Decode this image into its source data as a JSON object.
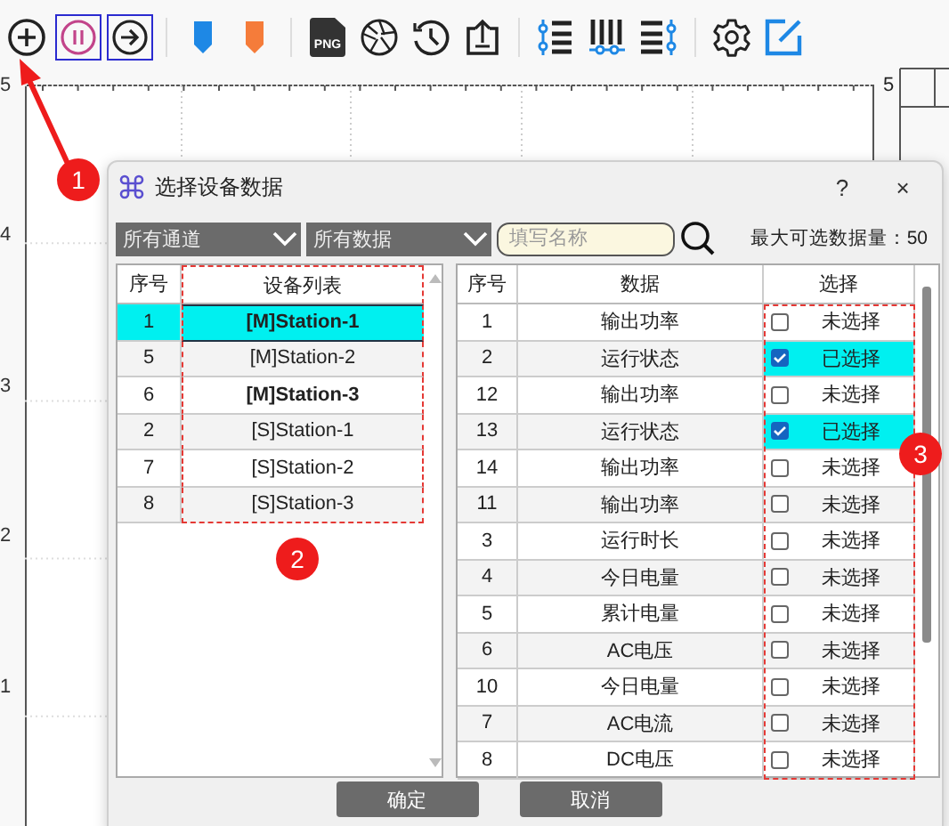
{
  "toolbar": [
    {
      "kind": "add",
      "active": false
    },
    {
      "kind": "pause",
      "active": true
    },
    {
      "kind": "next",
      "active": true
    },
    {
      "kind": "separator"
    },
    {
      "kind": "marker-blue",
      "active": false
    },
    {
      "kind": "marker-orange",
      "active": false
    },
    {
      "kind": "separator"
    },
    {
      "kind": "png",
      "text": "PNG",
      "active": false
    },
    {
      "kind": "aperture",
      "active": false
    },
    {
      "kind": "history",
      "active": false
    },
    {
      "kind": "upload",
      "active": false
    },
    {
      "kind": "separator"
    },
    {
      "kind": "list-left",
      "active": false
    },
    {
      "kind": "columns",
      "active": false
    },
    {
      "kind": "list-right",
      "active": false
    },
    {
      "kind": "separator"
    },
    {
      "kind": "settings",
      "active": false
    },
    {
      "kind": "edit",
      "active": false
    }
  ],
  "chart": {
    "left_ticks": [
      "5",
      "4",
      "3",
      "2",
      "1"
    ],
    "right_ticks": [
      "5"
    ]
  },
  "dialog": {
    "title": "选择设备数据",
    "help": "?",
    "close": "×",
    "filters": [
      {
        "value": "所有通道"
      },
      {
        "value": "所有数据"
      }
    ],
    "search": {
      "placeholder": "填写名称"
    },
    "limit_label": "最大可选数据量：50",
    "device_table": {
      "columns": [
        "序号",
        "设备列表"
      ],
      "rows": [
        {
          "no": "1",
          "name": "[M]Station-1",
          "selected": true,
          "bold": true
        },
        {
          "no": "5",
          "name": "[M]Station-2",
          "selected": false,
          "bold": false
        },
        {
          "no": "6",
          "name": "[M]Station-3",
          "selected": false,
          "bold": true
        },
        {
          "no": "2",
          "name": "[S]Station-1",
          "selected": false,
          "bold": false
        },
        {
          "no": "7",
          "name": "[S]Station-2",
          "selected": false,
          "bold": false
        },
        {
          "no": "8",
          "name": "[S]Station-3",
          "selected": false,
          "bold": false
        }
      ]
    },
    "data_table": {
      "columns": [
        "序号",
        "数据",
        "选择"
      ],
      "rows": [
        {
          "no": "1",
          "data": "输出功率",
          "checked": false,
          "status": "未选择"
        },
        {
          "no": "2",
          "data": "运行状态",
          "checked": true,
          "status": "已选择"
        },
        {
          "no": "12",
          "data": "输出功率",
          "checked": false,
          "status": "未选择"
        },
        {
          "no": "13",
          "data": "运行状态",
          "checked": true,
          "status": "已选择"
        },
        {
          "no": "14",
          "data": "输出功率",
          "checked": false,
          "status": "未选择"
        },
        {
          "no": "11",
          "data": "输出功率",
          "checked": false,
          "status": "未选择"
        },
        {
          "no": "3",
          "data": "运行时长",
          "checked": false,
          "status": "未选择"
        },
        {
          "no": "4",
          "data": "今日电量",
          "checked": false,
          "status": "未选择"
        },
        {
          "no": "5",
          "data": "累计电量",
          "checked": false,
          "status": "未选择"
        },
        {
          "no": "6",
          "data": "AC电压",
          "checked": false,
          "status": "未选择"
        },
        {
          "no": "10",
          "data": "今日电量",
          "checked": false,
          "status": "未选择"
        },
        {
          "no": "7",
          "data": "AC电流",
          "checked": false,
          "status": "未选择"
        },
        {
          "no": "8",
          "data": "DC电压",
          "checked": false,
          "status": "未选择"
        }
      ]
    },
    "buttons": [
      "确定",
      "取消"
    ]
  },
  "annotations": [
    {
      "label": "1"
    },
    {
      "label": "2"
    },
    {
      "label": "3"
    }
  ]
}
